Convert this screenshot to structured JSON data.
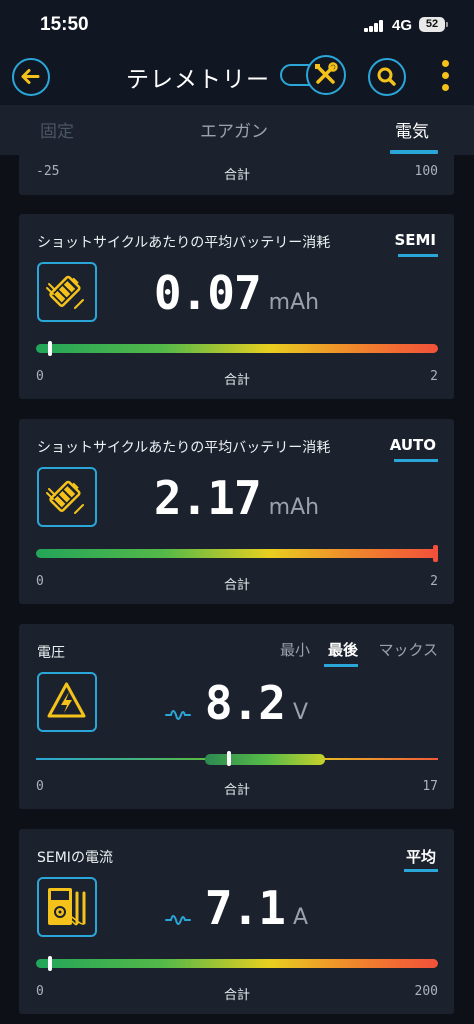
{
  "status_bar": {
    "time": "15:50",
    "network": "4G",
    "battery": "52"
  },
  "header": {
    "title": "テレメトリー"
  },
  "tabs": [
    {
      "label": "固定"
    },
    {
      "label": "エアガン"
    },
    {
      "label": "電気",
      "active": true
    }
  ],
  "partial_card": {
    "min": "-25",
    "label": "合計",
    "max": "100"
  },
  "cards": [
    {
      "title": "ショットサイクルあたりの平均バッテリー消耗",
      "mode": "SEMI",
      "value": "0.07",
      "unit": "mAh",
      "gauge": {
        "min": "0",
        "label": "合計",
        "max": "2",
        "level": 0.035
      }
    },
    {
      "title": "ショットサイクルあたりの平均バッテリー消耗",
      "mode": "AUTO",
      "value": "2.17",
      "unit": "mAh",
      "gauge": {
        "min": "0",
        "label": "合計",
        "max": "2",
        "level": 1.0
      }
    },
    {
      "title": "電圧",
      "modes": [
        "最小",
        "最後",
        "マックス"
      ],
      "active_mode": "最後",
      "value": "8.2",
      "unit": "V",
      "gauge": {
        "min": "0",
        "label": "合計",
        "max": "17",
        "level": 0.48,
        "range_low": 0.42,
        "range_high": 0.72
      }
    },
    {
      "title": "SEMIの電流",
      "mode": "平均",
      "value": "7.1",
      "unit": "A",
      "gauge": {
        "min": "0",
        "label": "合計",
        "max": "200",
        "level": 0.035
      }
    }
  ],
  "colors": {
    "accent": "#2aa6d9",
    "yellow": "#f4c21a",
    "card_bg": "#1b222d",
    "bg": "#0d1117"
  },
  "icons": {
    "back": "arrow-left-icon",
    "tool_toggle": "tools-icon",
    "search": "search-icon",
    "more": "more-vertical-icon",
    "battery": "battery-charging-icon",
    "voltage": "high-voltage-warning-icon",
    "current": "multimeter-icon",
    "wave": "waveform-icon"
  }
}
